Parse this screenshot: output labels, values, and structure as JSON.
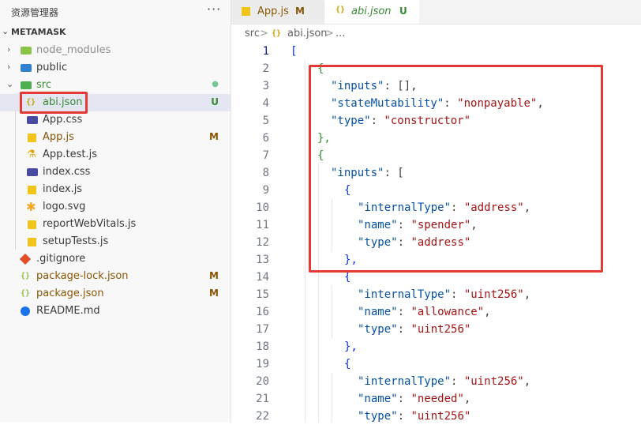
{
  "explorer": {
    "title": "资源管理器",
    "more": "···",
    "root_label": "METAMASK",
    "items": [
      {
        "name": "node_modules",
        "badge": ""
      },
      {
        "name": "public",
        "badge": ""
      },
      {
        "name": "src",
        "badge": "●"
      },
      {
        "name": "abi.json",
        "badge": "U"
      },
      {
        "name": "App.css",
        "badge": ""
      },
      {
        "name": "App.js",
        "badge": "M"
      },
      {
        "name": "App.test.js",
        "badge": ""
      },
      {
        "name": "index.css",
        "badge": ""
      },
      {
        "name": "index.js",
        "badge": ""
      },
      {
        "name": "logo.svg",
        "badge": ""
      },
      {
        "name": "reportWebVitals.js",
        "badge": ""
      },
      {
        "name": "setupTests.js",
        "badge": ""
      },
      {
        "name": ".gitignore",
        "badge": ""
      },
      {
        "name": "package-lock.json",
        "badge": "M"
      },
      {
        "name": "package.json",
        "badge": "M"
      },
      {
        "name": "README.md",
        "badge": ""
      }
    ]
  },
  "tabs": [
    {
      "name": "App.js",
      "badge": "M"
    },
    {
      "name": "abi.json",
      "badge": "U"
    }
  ],
  "breadcrumb": {
    "seg1": "src",
    "sep": ">",
    "seg2": "abi.json",
    "seg3": "..."
  },
  "colors": {
    "accent_red": "#e53935",
    "modified": "#895503",
    "untracked": "#388a34"
  },
  "code": {
    "line_numbers": [
      "1",
      "2",
      "3",
      "4",
      "5",
      "6",
      "7",
      "8",
      "9",
      "10",
      "11",
      "12",
      "13",
      "14",
      "15",
      "16",
      "17",
      "18",
      "19",
      "20",
      "21",
      "22"
    ],
    "l1": "[",
    "l2": "{",
    "l3k": "\"inputs\"",
    "l3p": ": [],",
    "l4k": "\"stateMutability\"",
    "l4c": ": ",
    "l4s": "\"nonpayable\"",
    "l4e": ",",
    "l5k": "\"type\"",
    "l5c": ": ",
    "l5s": "\"constructor\"",
    "l6": "},",
    "l7": "{",
    "l8k": "\"inputs\"",
    "l8p": ": [",
    "l9": "{",
    "l10k": "\"internalType\"",
    "l10c": ": ",
    "l10s": "\"address\"",
    "l10e": ",",
    "l11k": "\"name\"",
    "l11c": ": ",
    "l11s": "\"spender\"",
    "l11e": ",",
    "l12k": "\"type\"",
    "l12c": ": ",
    "l12s": "\"address\"",
    "l13": "},",
    "l14": "{",
    "l15k": "\"internalType\"",
    "l15c": ": ",
    "l15s": "\"uint256\"",
    "l15e": ",",
    "l16k": "\"name\"",
    "l16c": ": ",
    "l16s": "\"allowance\"",
    "l16e": ",",
    "l17k": "\"type\"",
    "l17c": ": ",
    "l17s": "\"uint256\"",
    "l18": "},",
    "l19": "{",
    "l20k": "\"internalType\"",
    "l20c": ": ",
    "l20s": "\"uint256\"",
    "l20e": ",",
    "l21k": "\"name\"",
    "l21c": ": ",
    "l21s": "\"needed\"",
    "l21e": ",",
    "l22k": "\"type\"",
    "l22c": ": ",
    "l22s": "\"uint256\""
  }
}
